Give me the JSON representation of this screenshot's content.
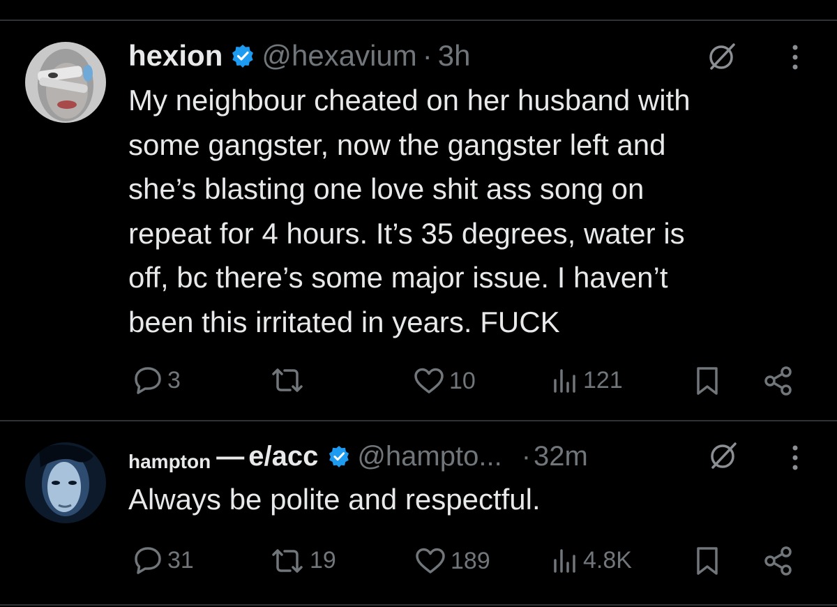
{
  "tweets": [
    {
      "display_name": "hexion",
      "handle": "@hexavium",
      "separator": "·",
      "time": "3h",
      "text": "My neighbour cheated on her husband with some gangster, now the gangster left and she’s blasting one love shit ass song on repeat for 4 hours. It’s 35 degrees, water is off, bc there’s some major issue. I haven’t been this irritated in years. FUCK",
      "lines": [
        "My neighbour cheated on her husband with",
        "some gangster, now the gangster left and",
        "she’s blasting one love shit ass song on",
        "repeat for 4 hours. It’s 35 degrees, water is",
        "off, bc there’s some major issue. I haven’t",
        "been this irritated in years. FUCK"
      ],
      "replies": "3",
      "reposts": "",
      "likes": "10",
      "views": "121"
    },
    {
      "display_name_small": "hampton",
      "display_name_dash": "—",
      "display_name_large": "e/acc",
      "handle": "@hampto...",
      "separator": "·",
      "time": "32m",
      "text": "Always be polite and respectful.",
      "replies": "31",
      "reposts": "19",
      "likes": "189",
      "views": "4.8K"
    }
  ],
  "icons": {
    "reply": "speech-bubble-icon",
    "repost": "repost-arrows-icon",
    "like": "heart-icon",
    "views": "bar-chart-icon",
    "bookmark": "bookmark-icon",
    "share": "share-icon",
    "grok": "slashed-circle-icon",
    "more": "more-vertical-icon",
    "verified": "verified-badge-icon"
  },
  "colors": {
    "background": "#000000",
    "primary_text": "#e7e9ea",
    "secondary_text": "#71767b",
    "verified_blue": "#1d9bf0",
    "divider": "#2f3336"
  }
}
